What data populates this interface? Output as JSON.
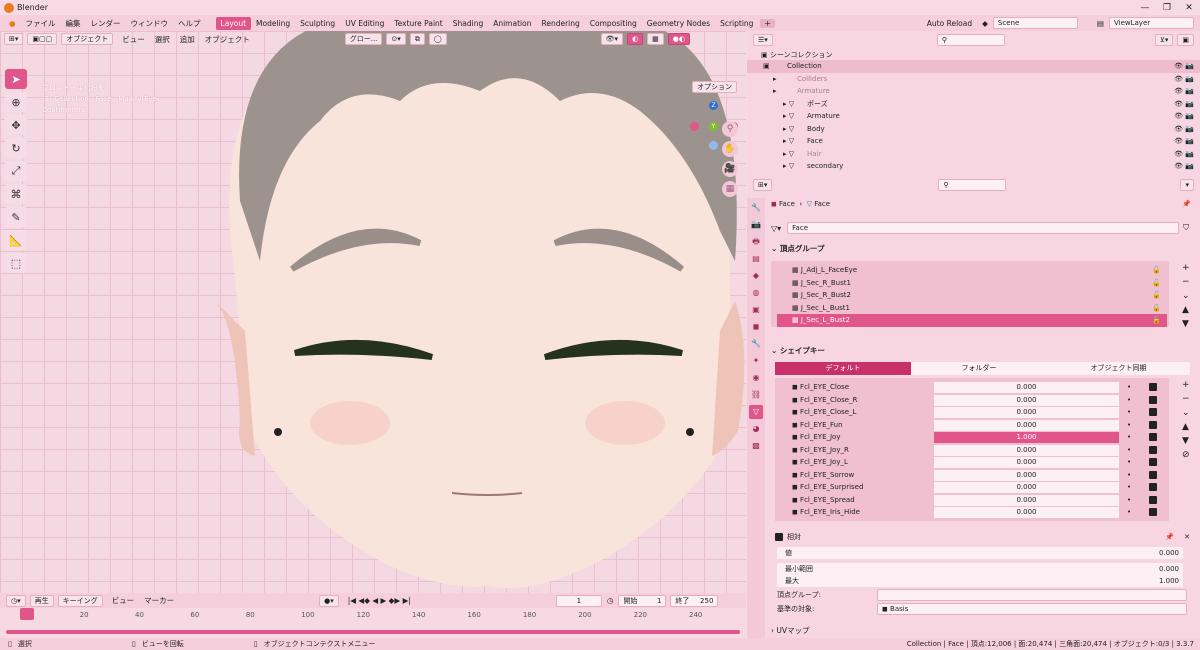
{
  "app": {
    "title": "Blender"
  },
  "menu": {
    "items": [
      "ファイル",
      "編集",
      "レンダー",
      "ウィンドウ",
      "ヘルプ"
    ],
    "workspaces": [
      "Layout",
      "Modeling",
      "Sculpting",
      "UV Editing",
      "Texture Paint",
      "Shading",
      "Animation",
      "Rendering",
      "Compositing",
      "Geometry Nodes",
      "Scripting"
    ],
    "active_ws": "Layout",
    "auto_reload": "Auto Reload",
    "scene": "Scene",
    "view_layer": "ViewLayer"
  },
  "viewport": {
    "mode": "オブジェクト",
    "menus": [
      "ビュー",
      "選択",
      "追加",
      "オブジェクト"
    ],
    "transform": "グロー...",
    "options": "オプション",
    "info": [
      "ブロント・平行投影",
      "(1) Collection | Face : Modify(Eye)",
      "Centimeters"
    ],
    "axes": {
      "x": "X",
      "y": "Y",
      "z": "Z"
    }
  },
  "timeline": {
    "playback": "再生",
    "keying": "キーイング",
    "view": "ビュー",
    "marker": "マーカー",
    "current": "1",
    "start_label": "開始",
    "start": "1",
    "end_label": "終了",
    "end": "250",
    "ticks": [
      "1",
      "20",
      "40",
      "60",
      "80",
      "100",
      "120",
      "140",
      "160",
      "180",
      "200",
      "220",
      "240"
    ]
  },
  "status": {
    "select": "選択",
    "rotate": "ビューを回転",
    "context": "オブジェクトコンテクストメニュー",
    "stats": "Collection | Face | 頂点:12,006 | 面:20,474 | 三角面:20,474 | オブジェクト:0/3 | 3.3.7"
  },
  "outliner": {
    "title": "シーンコレクション",
    "rows": [
      {
        "label": "Collection",
        "indent": 1
      },
      {
        "label": "Colliders",
        "indent": 2
      },
      {
        "label": "Armature",
        "indent": 2
      },
      {
        "label": "ポーズ",
        "indent": 3
      },
      {
        "label": "Armature",
        "indent": 3
      },
      {
        "label": "Body",
        "indent": 3
      },
      {
        "label": "Face",
        "indent": 3
      },
      {
        "label": "Hair",
        "indent": 3
      },
      {
        "label": "secondary",
        "indent": 3
      }
    ]
  },
  "props": {
    "crumb_obj": "Face",
    "crumb_mesh": "Face",
    "mesh_name": "Face",
    "vgroups_title": "頂点グループ",
    "vgroups": [
      "J_Adj_L_FaceEye",
      "J_Sec_R_Bust1",
      "J_Sec_R_Bust2",
      "J_Sec_L_Bust1",
      "J_Sec_L_Bust2"
    ],
    "vgroup_active": 4,
    "shapekeys_title": "シェイプキー",
    "sk_tabs": [
      "デフォルト",
      "フォルダー",
      "オブジェクト同期"
    ],
    "shapekeys": [
      {
        "name": "Fcl_EYE_Close",
        "value": "0.000"
      },
      {
        "name": "Fcl_EYE_Close_R",
        "value": "0.000"
      },
      {
        "name": "Fcl_EYE_Close_L",
        "value": "0.000"
      },
      {
        "name": "Fcl_EYE_Fun",
        "value": "0.000"
      },
      {
        "name": "Fcl_EYE_Joy",
        "value": "1.000"
      },
      {
        "name": "Fcl_EYE_Joy_R",
        "value": "0.000"
      },
      {
        "name": "Fcl_EYE_Joy_L",
        "value": "0.000"
      },
      {
        "name": "Fcl_EYE_Sorrow",
        "value": "0.000"
      },
      {
        "name": "Fcl_EYE_Surprised",
        "value": "0.000"
      },
      {
        "name": "Fcl_EYE_Spread",
        "value": "0.000"
      },
      {
        "name": "Fcl_EYE_Iris_Hide",
        "value": "0.000"
      }
    ],
    "shapekey_active": 4,
    "relative": "相対",
    "value_label": "値",
    "value": "0.000",
    "min_label": "最小範囲",
    "min": "0.000",
    "max_label": "最大",
    "max": "1.000",
    "vgroup_label": "頂点グループ:",
    "basis_label": "基準の対象:",
    "basis": "Basis",
    "uvmap": "UVマップ"
  },
  "colors": {
    "accent": "#e0558a",
    "bg": "#f7dbe4"
  }
}
